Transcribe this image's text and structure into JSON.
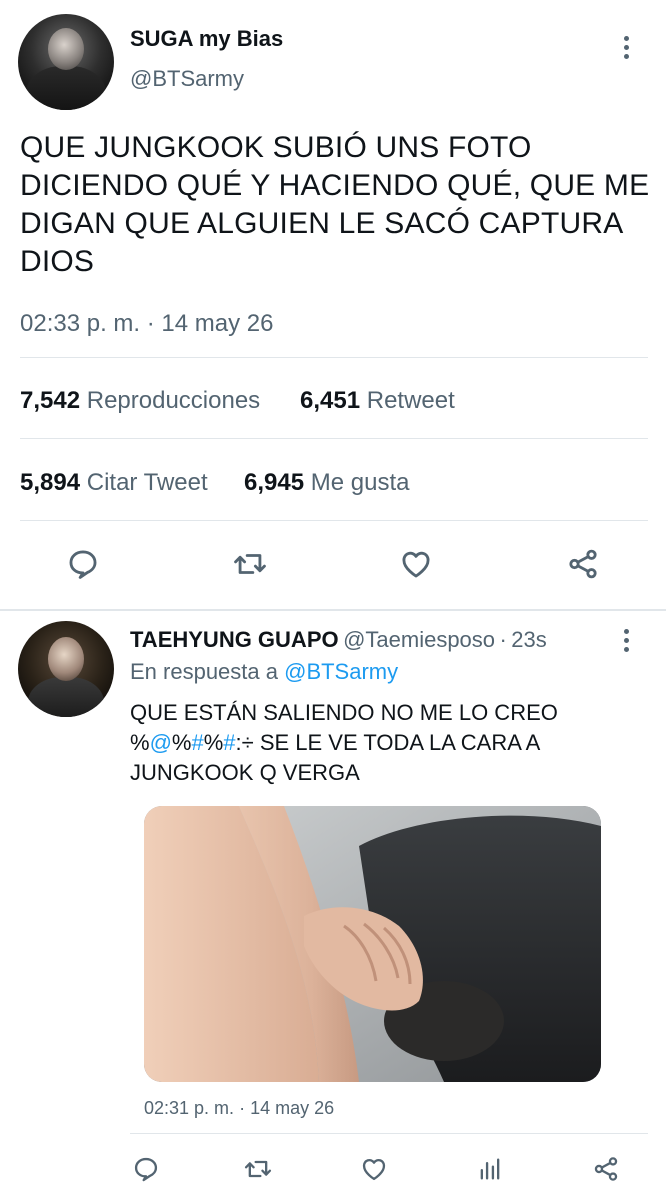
{
  "main_tweet": {
    "author": {
      "display_name": "SUGA my Bias",
      "handle": "@BTSarmy"
    },
    "text_lines": [
      "QUE JUNGKOOK SUBIÓ UNS FOTO",
      "DICIENDO QUÉ Y HACIENDO QUÉ, QUE ME",
      "DIGAN QUE ALGUIEN LE SACÓ CAPTURA",
      "DIOS"
    ],
    "time": "02:33 p. m.",
    "separator": "·",
    "date": "14 may 26",
    "stats": {
      "views_count": "7,542",
      "views_label": "Reproducciones",
      "retweets_count": "6,451",
      "retweets_label": "Retweet",
      "quotes_count": "5,894",
      "quotes_label": "Citar Tweet",
      "likes_count": "6,945",
      "likes_label": "Me gusta"
    },
    "actions": [
      "reply-icon",
      "retweet-icon",
      "like-icon",
      "share-icon"
    ]
  },
  "reply": {
    "author": {
      "display_name": "TAEHYUNG GUAPO",
      "handle": "@Taemiesposo",
      "separator": "·",
      "age": "23s"
    },
    "reply_prefix": "En respuesta a",
    "reply_mention": "@BTSarmy",
    "text": {
      "line1": "QUE ESTÁN SALIENDO NO ME LO CREO",
      "line2_start": "%",
      "line2_at": "@",
      "line2_mid1": "%",
      "line2_hash1": "#",
      "line2_mid2": "%",
      "line2_hash2": "#",
      "line2_end": ":÷ SE LE VE TODA LA CARA A",
      "line3": "JUNGKOOK Q VERGA"
    },
    "time": "02:31 p. m.",
    "separator": "·",
    "date": "14 may 26",
    "actions": [
      "reply-icon",
      "retweet-icon",
      "like-icon",
      "analytics-icon",
      "share-icon"
    ]
  },
  "colors": {
    "link": "#1d9bf0",
    "secondary_text": "#536471",
    "divider": "#e1e6ea"
  }
}
